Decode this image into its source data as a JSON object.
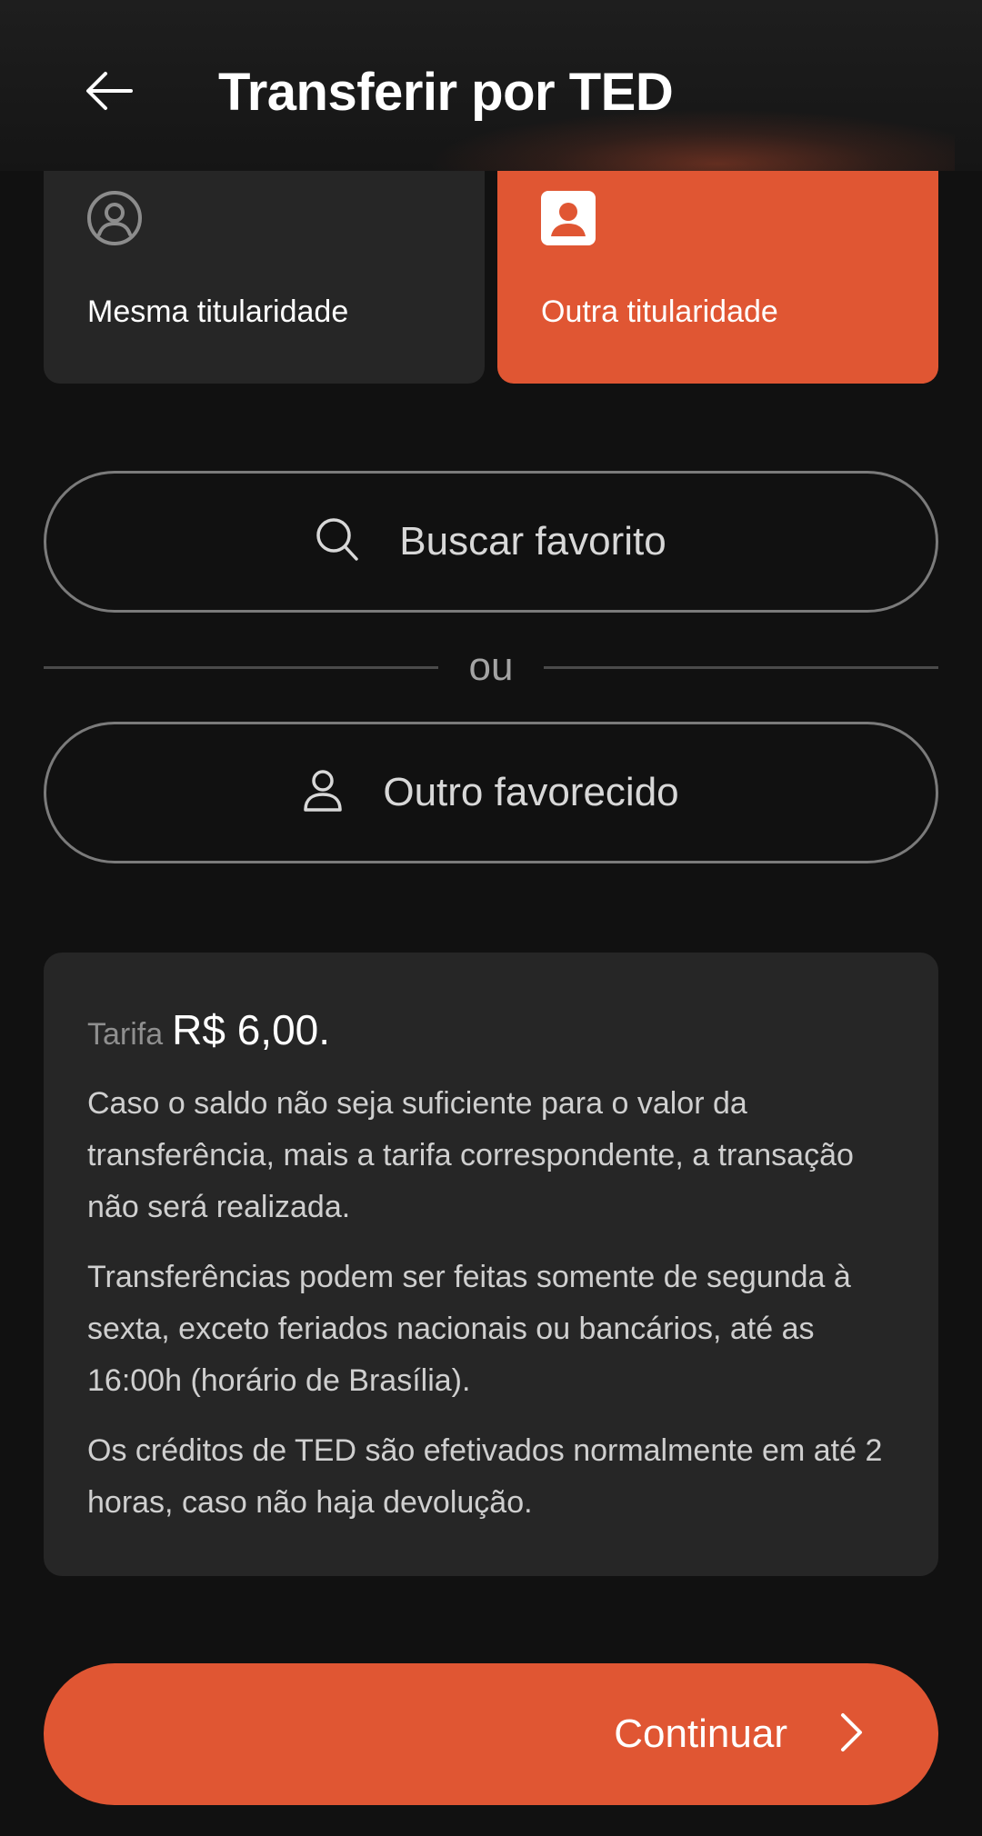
{
  "header": {
    "title": "Transferir por TED",
    "back_icon": "arrow-left-icon"
  },
  "ownership": {
    "options": [
      {
        "label": "Mesma titularidade",
        "icon": "user-circle-icon",
        "selected": false
      },
      {
        "label": "Outra titularidade",
        "icon": "user-badge-icon",
        "selected": true
      }
    ]
  },
  "search": {
    "label": "Buscar favorito",
    "icon": "search-icon"
  },
  "divider": {
    "label": "ou"
  },
  "other_payee": {
    "label": "Outro favorecido",
    "icon": "user-icon"
  },
  "info": {
    "fee_label": "Tarifa",
    "fee_value": "R$ 6,00.",
    "paragraphs": [
      "Caso o saldo não seja suficiente para o valor da transferência, mais a tarifa correspondente, a transação não será realizada.",
      "Transferências podem ser feitas somente de segunda à sexta, exceto feriados nacionais ou bancários, até as 16:00h (horário de Brasília).",
      "Os créditos de TED são efetivados normalmente em até 2 horas, caso não haja devolução."
    ]
  },
  "footer": {
    "continue_label": "Continuar",
    "continue_icon": "chevron-right-icon"
  },
  "colors": {
    "accent": "#e05633",
    "background": "#111111",
    "card": "#262626",
    "border": "#7b7b7b"
  }
}
